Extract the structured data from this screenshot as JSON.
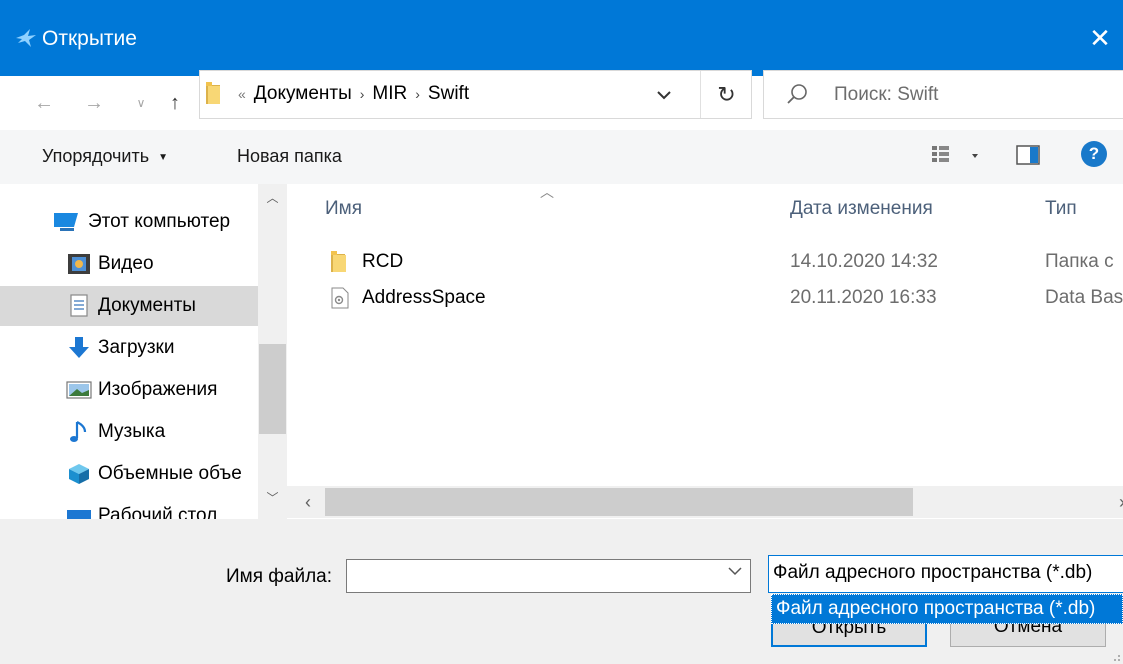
{
  "window": {
    "title": "Открытие",
    "app_icon": "swift-bird-icon",
    "close_icon": "close-icon"
  },
  "nav": {
    "back_icon": "arrow-left-icon",
    "forward_icon": "arrow-right-icon",
    "recent_icon": "chevron-down-icon",
    "up_icon": "arrow-up-icon"
  },
  "address": {
    "overflow": "«",
    "crumbs": [
      "Документы",
      "MIR",
      "Swift"
    ],
    "dropdown_icon": "chevron-down-icon",
    "refresh_icon": "refresh-icon"
  },
  "search": {
    "placeholder": "Поиск: Swift",
    "icon": "search-icon"
  },
  "toolbar": {
    "organize_label": "Упорядочить",
    "new_folder_label": "Новая папка",
    "views_icon": "details-view-icon",
    "preview_icon": "preview-pane-icon",
    "help_label": "?"
  },
  "sidebar": {
    "items": [
      {
        "label": "Этот компьютер",
        "icon": "computer-icon"
      },
      {
        "label": "Видео",
        "icon": "video-icon"
      },
      {
        "label": "Документы",
        "icon": "documents-icon",
        "selected": true
      },
      {
        "label": "Загрузки",
        "icon": "downloads-icon"
      },
      {
        "label": "Изображения",
        "icon": "pictures-icon"
      },
      {
        "label": "Музыка",
        "icon": "music-icon"
      },
      {
        "label": "Объемные объе",
        "icon": "3d-objects-icon"
      },
      {
        "label": "Рабочий стол",
        "icon": "desktop-icon"
      }
    ]
  },
  "files": {
    "columns": {
      "name": "Имя",
      "date": "Дата изменения",
      "type": "Тип"
    },
    "rows": [
      {
        "name": "RCD",
        "date": "14.10.2020 14:32",
        "type": "Папка с",
        "icon": "folder-icon"
      },
      {
        "name": "AddressSpace",
        "date": "20.11.2020 16:33",
        "type": "Data Bas",
        "icon": "database-file-icon"
      }
    ]
  },
  "bottom": {
    "filename_label": "Имя файла:",
    "filename_value": "",
    "filter_selected": "Файл адресного пространства (*.db)",
    "filter_options": [
      "Файл адресного пространства (*.db)"
    ],
    "open_label": "Открыть",
    "cancel_label": "Отмена"
  },
  "colors": {
    "accent": "#0078d7",
    "selected_bg": "#d9d9d9"
  }
}
